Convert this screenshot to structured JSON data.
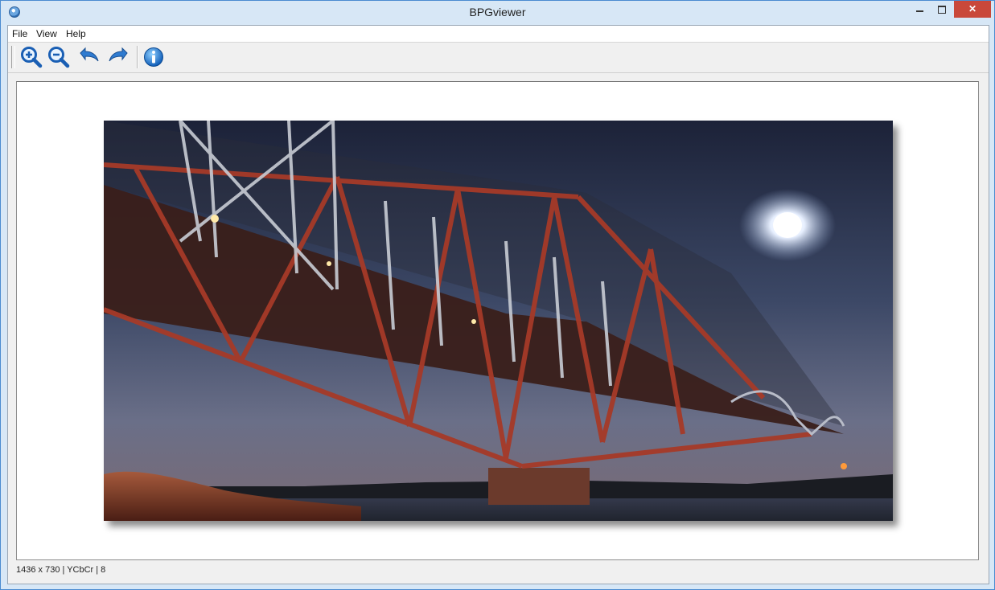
{
  "window": {
    "title": "BPGviewer"
  },
  "menu": {
    "items": [
      "File",
      "View",
      "Help"
    ]
  },
  "toolbar": {
    "icons": [
      "zoom-in-icon",
      "zoom-out-icon",
      "rotate-left-icon",
      "rotate-right-icon",
      "info-icon"
    ]
  },
  "image": {
    "description": "bridge-at-night"
  },
  "status": {
    "text": "1436 x 730 | YCbCr | 8"
  },
  "colors": {
    "titlebar": "#d7e7f6",
    "close": "#c9483a",
    "accent": "#1a73c8"
  }
}
